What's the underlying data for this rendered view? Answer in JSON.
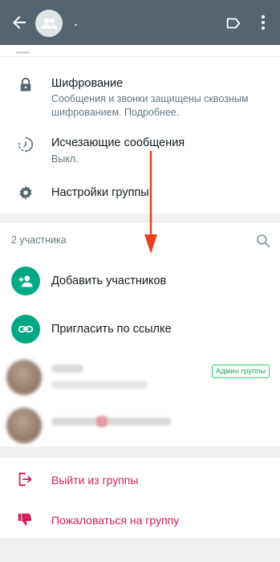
{
  "header": {
    "title": ".",
    "back_icon": "arrow-back-icon",
    "avatar_icon": "group-avatar-icon",
    "label_icon": "label-icon",
    "menu_icon": "more-vert-icon",
    "bar_color": "#54656f"
  },
  "settings": {
    "encryption_title": "Шифрование",
    "encryption_desc": "Сообщения и звонки защищены сквозным шифрованием. Подробнее.",
    "disappearing_title": "Исчезающие сообщения",
    "disappearing_value": "Выкл.",
    "group_settings": "Настройки группы"
  },
  "members": {
    "count_label": "2 участника",
    "add_label": "Добавить участников",
    "invite_label": "Пригласить по ссылке",
    "admin_badge": "Админ группы",
    "accent_color": "#00a884"
  },
  "actions": {
    "exit_label": "Выйти из группы",
    "report_label": "Пожаловаться на группу",
    "danger_color": "#d11f5a"
  },
  "annotation": {
    "arrow_color": "#e8401c"
  }
}
